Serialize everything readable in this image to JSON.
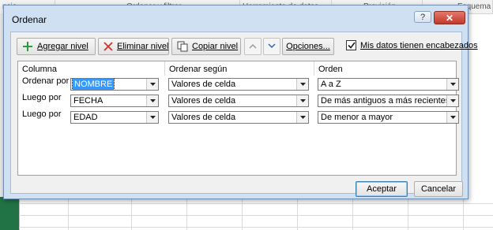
{
  "background_sheet": {
    "column_headers": [
      "ncia",
      "Ordenar y filtrar",
      "Herramienta de datos",
      "Previsión",
      "Esquema"
    ]
  },
  "dialog": {
    "title": "Ordenar",
    "help_label": "?",
    "close_label": "✕",
    "toolbar": {
      "add_level": "Agregar nivel",
      "delete_level": "Eliminar nivel",
      "copy_level": "Copiar nivel",
      "options": "Opciones...",
      "headers_checkbox_label": "Mis datos tienen encabezados",
      "headers_checked": true
    },
    "columns": {
      "column": "Columna",
      "sort_on": "Ordenar según",
      "order": "Orden"
    },
    "rows": [
      {
        "label": "Ordenar por",
        "column": "NOMBRE",
        "sort_on": "Valores de celda",
        "order": "A a Z"
      },
      {
        "label": "Luego por",
        "column": "FECHA",
        "sort_on": "Valores de celda",
        "order": "De más antiguos a más recientes"
      },
      {
        "label": "Luego por",
        "column": "EDAD",
        "sort_on": "Valores de celda",
        "order": "De menor a mayor"
      }
    ],
    "accept_label": "Aceptar",
    "cancel_label": "Cancelar"
  },
  "colors": {
    "dialog_frame": "#cfe0f3",
    "close_button": "#c1392b",
    "selection": "#3399ff",
    "excel_green": "#217346"
  }
}
